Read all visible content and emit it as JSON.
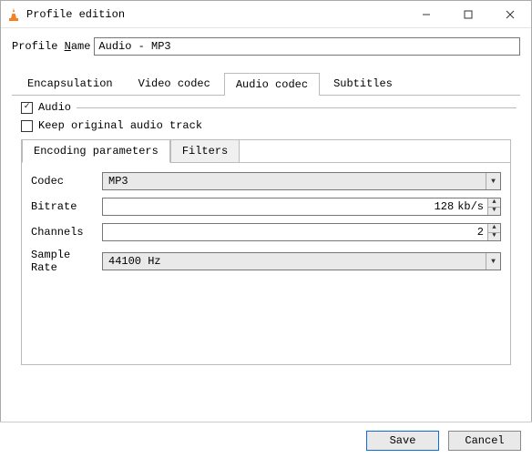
{
  "window": {
    "title": "Profile edition"
  },
  "profile": {
    "label": "Profile Name",
    "accel": "N",
    "value": "Audio - MP3"
  },
  "tabs": {
    "items": [
      {
        "label": "Encapsulation"
      },
      {
        "label": "Video codec"
      },
      {
        "label": "Audio codec"
      },
      {
        "label": "Subtitles"
      }
    ],
    "active_index": 2
  },
  "audio_tab": {
    "audio_checkbox": {
      "label": "Audio",
      "checked": true
    },
    "keep_original_checkbox": {
      "label": "Keep original audio track",
      "checked": false
    },
    "inner_tabs": {
      "items": [
        {
          "label": "Encoding parameters"
        },
        {
          "label": "Filters"
        }
      ],
      "active_index": 0
    },
    "encoding": {
      "codec": {
        "label": "Codec",
        "value": "MP3"
      },
      "bitrate": {
        "label": "Bitrate",
        "value": "128",
        "unit": "kb/s"
      },
      "channels": {
        "label": "Channels",
        "value": "2"
      },
      "sample_rate": {
        "label": "Sample Rate",
        "value": "44100 Hz"
      }
    }
  },
  "buttons": {
    "save": "Save",
    "cancel": "Cancel"
  }
}
